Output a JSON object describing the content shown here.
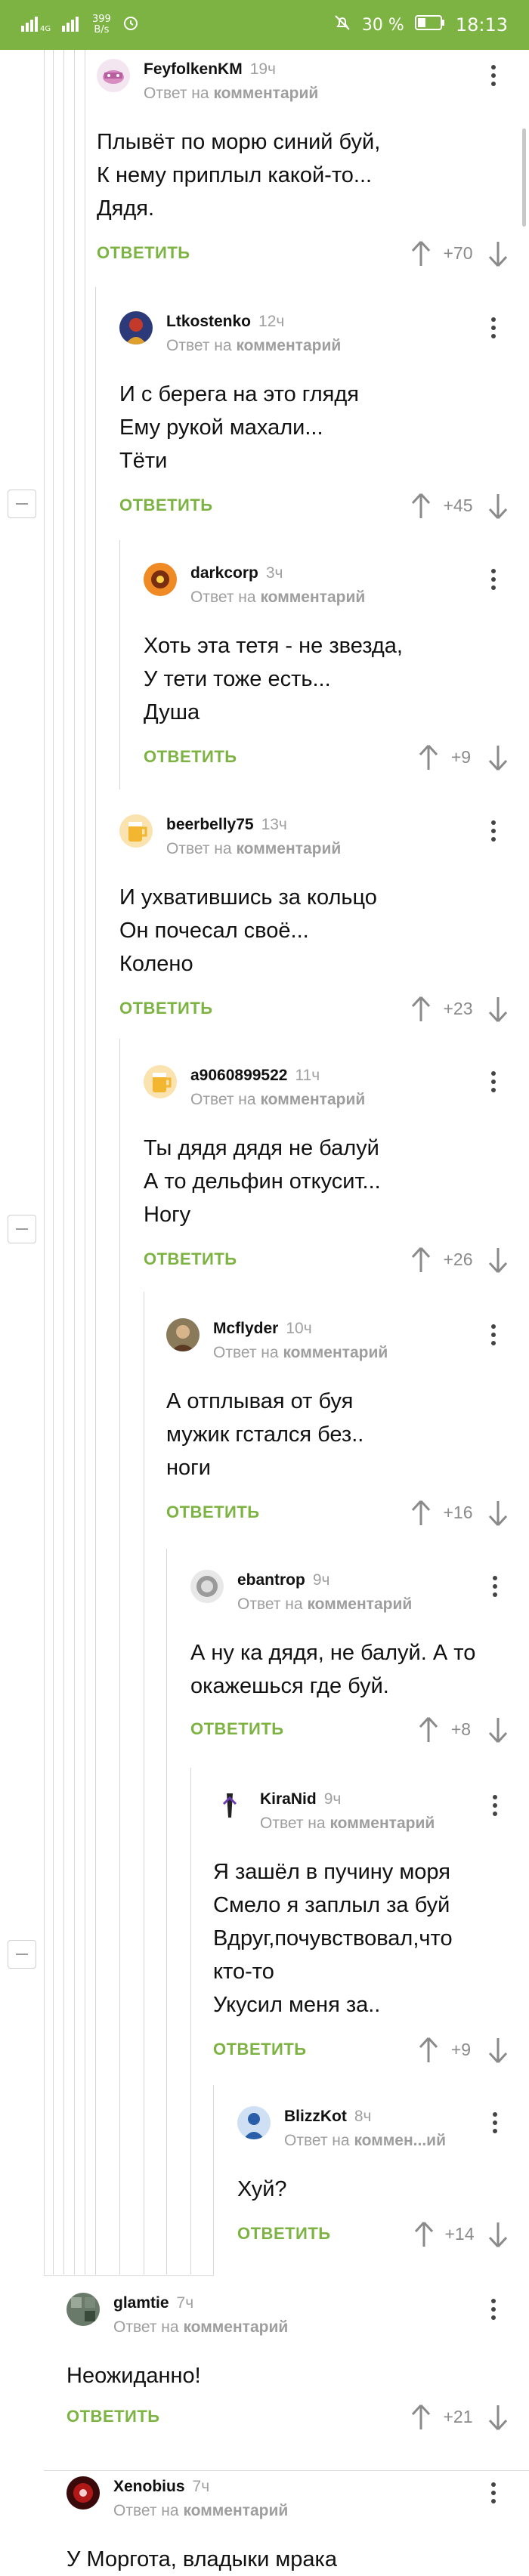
{
  "status_bar": {
    "speed_value": "399",
    "speed_unit": "B/s",
    "battery": "30 %",
    "time": "18:13"
  },
  "reply_label": "ОТВЕТИТЬ",
  "reply_prefix": "Ответ на",
  "reply_target": "комментарий",
  "comments": [
    {
      "author": "FeyfolkenKM",
      "time": "19ч",
      "reply_target": "комментарий",
      "lines": [
        "Плывёт по морю синий буй,",
        "К нему приплыл какой-то...",
        "Дядя."
      ],
      "rating": "+70"
    },
    {
      "author": "Ltkostenko",
      "time": "12ч",
      "reply_target": "комментарий",
      "lines": [
        "И с берега на это глядя",
        "Ему рукой махали...",
        "Тёти"
      ],
      "rating": "+45"
    },
    {
      "author": "darkcorp",
      "time": "3ч",
      "reply_target": "комментарий",
      "lines": [
        "Хоть эта тетя - не звезда,",
        "У тети тоже есть...",
        "Душа"
      ],
      "rating": "+9"
    },
    {
      "author": "beerbelly75",
      "time": "13ч",
      "reply_target": "комментарий",
      "lines": [
        "И ухватившись за кольцо",
        "Он почесал своё...",
        "Колено"
      ],
      "rating": "+23"
    },
    {
      "author": "a9060899522",
      "time": "11ч",
      "reply_target": "комментарий",
      "lines": [
        "Ты дядя дядя не балуй",
        "А то дельфин откусит...",
        "Ногу"
      ],
      "rating": "+26"
    },
    {
      "author": "Mcflyder",
      "time": "10ч",
      "reply_target": "комментарий",
      "lines": [
        "А отплывая от буя",
        "мужик гстался без..",
        "ноги"
      ],
      "rating": "+16"
    },
    {
      "author": "ebantrop",
      "time": "9ч",
      "reply_target": "комментарий",
      "lines": [
        "А ну ка дядя, не балуй. А то",
        "окажешься где буй."
      ],
      "rating": "+8"
    },
    {
      "author": "KiraNid",
      "time": "9ч",
      "reply_target": "комментарий",
      "lines": [
        "Я зашёл в пучину моря",
        "Смело я заплыл за буй",
        "Вдруг,почувствовал,что",
        "кто-то",
        "Укусил меня за.."
      ],
      "rating": "+9"
    },
    {
      "author": "BlizzKot",
      "time": "8ч",
      "reply_target": "коммен...ий",
      "lines": [
        "Хуй?"
      ],
      "rating": "+14"
    },
    {
      "author": "glamtie",
      "time": "7ч",
      "reply_target": "комментарий",
      "lines": [
        "Неожиданно!"
      ],
      "rating": "+21"
    },
    {
      "author": "Xenobius",
      "time": "7ч",
      "reply_target": "комментарий",
      "lines": [
        "У Моргота, владыки мрака"
      ],
      "rating": ""
    }
  ],
  "colors": {
    "accent": "#7cb342",
    "meta": "#9e9e9e",
    "thread_line": "#d6d6d6"
  }
}
